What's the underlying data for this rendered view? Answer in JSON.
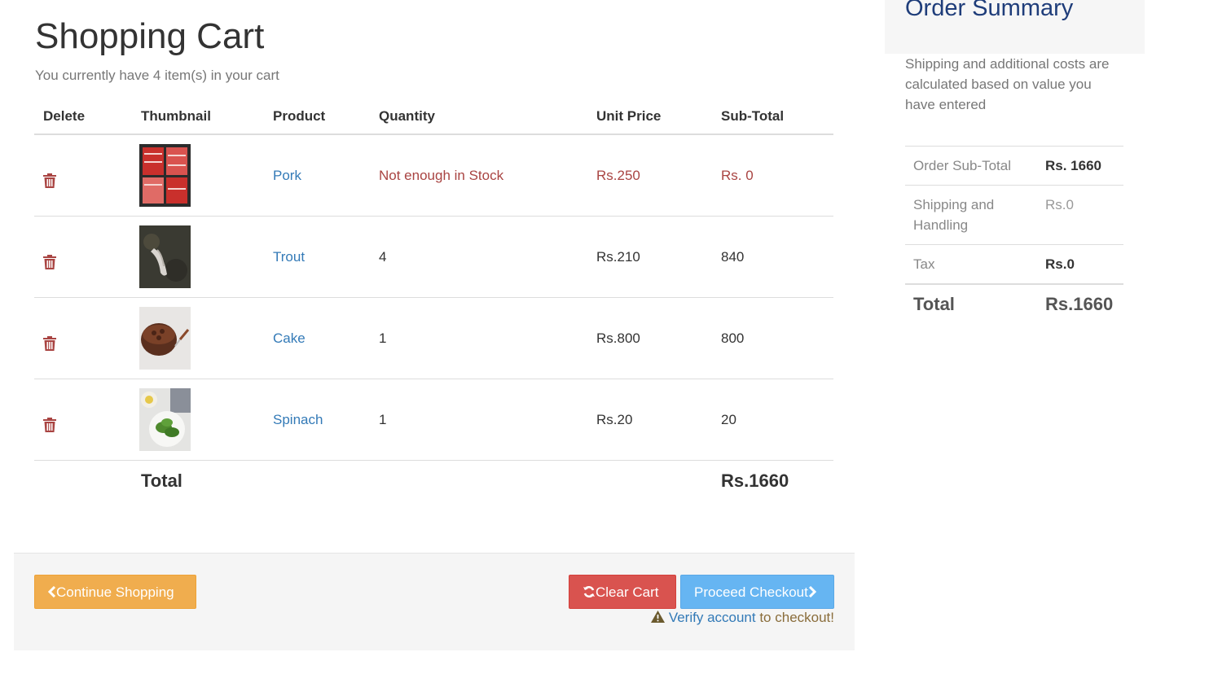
{
  "page": {
    "title": "Shopping Cart",
    "subtitle": "You currently have 4 item(s) in your cart"
  },
  "table": {
    "headers": [
      "Delete",
      "Thumbnail",
      "Product",
      "Quantity",
      "Unit Price",
      "Sub-Total"
    ],
    "rows": [
      {
        "product": "Pork",
        "quantity": "Not enough in Stock",
        "unit_price": "Rs.250",
        "subtotal": "Rs. 0"
      },
      {
        "product": "Trout",
        "quantity": "4",
        "unit_price": "Rs.210",
        "subtotal": "840"
      },
      {
        "product": "Cake",
        "quantity": "1",
        "unit_price": "Rs.800",
        "subtotal": "800"
      },
      {
        "product": "Spinach",
        "quantity": "1",
        "unit_price": "Rs.20",
        "subtotal": "20"
      }
    ],
    "total_label": "Total",
    "total_value": "Rs.1660"
  },
  "footer": {
    "continue_label": "Continue Shopping",
    "clear_label": "Clear Cart",
    "checkout_label": "Proceed Checkout",
    "verify_link": "Verify account",
    "verify_suffix": " to checkout!"
  },
  "summary": {
    "title": "Order Summary",
    "note": "Shipping and additional costs are calculated based on value you have entered",
    "rows": [
      {
        "label": "Order Sub-Total",
        "value": "Rs. 1660"
      },
      {
        "label": "Shipping and Handling",
        "value": "Rs.0"
      },
      {
        "label": "Tax",
        "value": "Rs.0"
      }
    ],
    "total_label": "Total",
    "total_value": "Rs.1660"
  },
  "colors": {
    "danger": "#d9534f",
    "warning": "#f0ad4e",
    "primary": "#66b5f2",
    "link": "#337ab7",
    "brand_title": "#1f3d7a"
  },
  "icons": {
    "delete": "trash-icon",
    "continue": "chevron-left-icon",
    "clear": "refresh-icon",
    "checkout": "chevron-right-icon",
    "verify": "warning-icon"
  }
}
